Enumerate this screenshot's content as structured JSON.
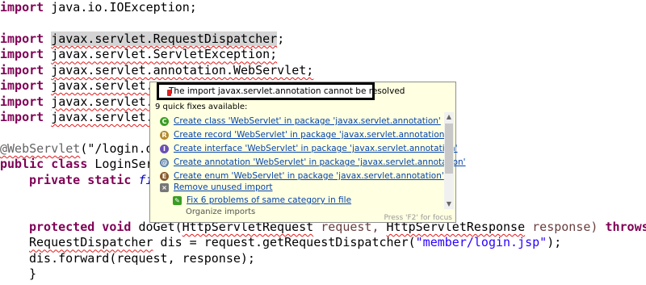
{
  "code": {
    "line1": "import java.io.IOException;",
    "kw_import": "import",
    "imp1_pkg": "java.io.IOException;",
    "imp2_pkg": "javax.servlet.RequestDispatcher",
    "imp2_semi": ";",
    "imp3_pkg": "javax.servlet.ServletException;",
    "imp4_pkg": "javax.servlet.annotation.WebServlet;",
    "imp5_pkg": "javax.servlet.",
    "imp6_pkg": "javax.servlet.",
    "imp7_pkg": "javax.servlet.",
    "anno_name": "@WebServlet",
    "anno_arg": "(\"/login.d",
    "kw_public_class": "public class",
    "class_name": " LoginSer",
    "kw_private_static": "private static",
    "fi_partial": " fi",
    "kw_protected_void": "protected void",
    "method_name": " doGet(",
    "param1_type": "HttpServletRequest",
    "param1_name": " request, ",
    "param2_type": "HttpServletResponse",
    "param2_name": " response) ",
    "kw_throws": "throws",
    "rd_type": "RequestDispatcher",
    "rd_decl": " dis = request.getRequestDispatcher(",
    "rd_str": "\"member/login.jsp\"",
    "rd_end": ");",
    "forward_line": "dis.forward(request, response);",
    "closing_brace": "}"
  },
  "popup": {
    "title": "The import javax.servlet.annotation cannot be resolved",
    "count": "9 quick fixes available:",
    "fixes": [
      {
        "label": "Create class 'WebServlet' in package 'javax.servlet.annotation'",
        "icon": "class-icon",
        "glyph": "C",
        "color": "#3a9d23"
      },
      {
        "label": "Create record 'WebServlet' in package 'javax.servlet.annotation'",
        "icon": "record-icon",
        "glyph": "R",
        "color": "#b58a2a"
      },
      {
        "label": "Create interface 'WebServlet' in package 'javax.servlet.annotation'",
        "icon": "interface-icon",
        "glyph": "I",
        "color": "#6a4fb5"
      },
      {
        "label": "Create annotation 'WebServlet' in package 'javax.servlet.annotation'",
        "icon": "annotation-icon",
        "glyph": "@",
        "color": "#5a7ea8"
      },
      {
        "label": "Create enum 'WebServlet' in package 'javax.servlet.annotation'",
        "icon": "enum-icon",
        "glyph": "E",
        "color": "#8a5a2a"
      },
      {
        "label": "Remove unused import",
        "icon": "remove-icon",
        "glyph": "×",
        "color": "#777777"
      },
      {
        "label": "Fix 6 problems of same category in file",
        "icon": "fix-all-icon",
        "glyph": "✎",
        "color": "#3a9d23"
      }
    ],
    "partial_item": "Organize imports",
    "focus_hint": "Press 'F2' for focus"
  }
}
